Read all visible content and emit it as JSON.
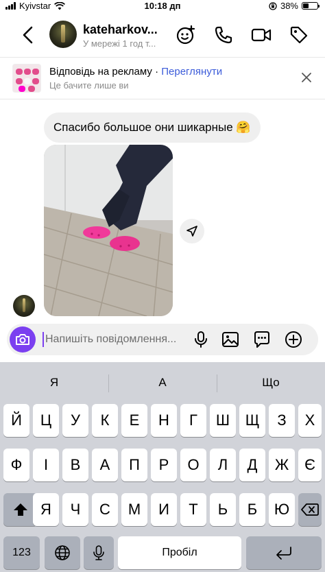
{
  "status_bar": {
    "carrier": "Kyivstar",
    "time": "10:18 дп",
    "battery": "38%",
    "battery_level": 0.38
  },
  "header": {
    "username": "kateharkov...",
    "status": "У мережі 1 год т...",
    "icons": [
      "back-icon",
      "effects-icon",
      "phone-icon",
      "video-icon",
      "tag-icon"
    ]
  },
  "ad_reply": {
    "title": "Відповідь на рекламу",
    "separator": "·",
    "action": "Переглянути",
    "subtitle": "Це бачите лише ви",
    "icons": [
      "close-icon"
    ]
  },
  "messages": {
    "text": "Спасибо большое они шикарные 🤗",
    "photo_alt": "photo",
    "icons": [
      "share-icon"
    ]
  },
  "composer": {
    "placeholder": "Напишіть повідомлення...",
    "accent": "#7b3ff0",
    "icons": [
      "camera-icon",
      "mic-icon",
      "gallery-icon",
      "sticker-icon",
      "plus-icon"
    ]
  },
  "keyboard": {
    "suggestions": [
      "Я",
      "А",
      "Що"
    ],
    "row1": [
      "Й",
      "Ц",
      "У",
      "К",
      "Е",
      "Н",
      "Г",
      "Ш",
      "Щ",
      "З",
      "Х"
    ],
    "row2": [
      "Ф",
      "І",
      "В",
      "А",
      "П",
      "Р",
      "О",
      "Л",
      "Д",
      "Ж",
      "Є"
    ],
    "row3": [
      "Я",
      "Ч",
      "С",
      "М",
      "И",
      "Т",
      "Ь",
      "Б",
      "Ю"
    ],
    "numbers_key": "123",
    "space_key": "Пробіл",
    "icons": [
      "shift-icon",
      "backspace-icon",
      "globe-icon",
      "dictation-icon",
      "return-icon"
    ]
  }
}
